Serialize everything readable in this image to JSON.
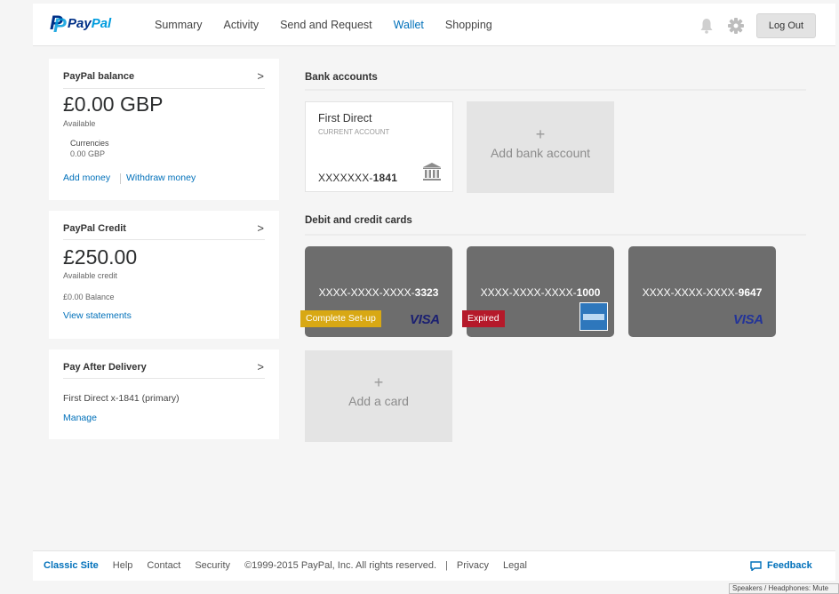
{
  "header": {
    "logo_pay": "Pay",
    "logo_pal": "Pal",
    "nav": [
      "Summary",
      "Activity",
      "Send and Request",
      "Wallet",
      "Shopping"
    ],
    "active_tab": "Wallet",
    "logout_label": "Log Out"
  },
  "balance": {
    "title": "PayPal balance",
    "chevron": ">",
    "amount": "£0.00 GBP",
    "amount_label": "Available",
    "currencies_label": "Currencies",
    "currencies_value": "0.00 GBP",
    "add_money": "Add money",
    "withdraw_money": "Withdraw money"
  },
  "credit": {
    "title": "PayPal Credit",
    "chevron": ">",
    "amount": "£250.00",
    "amount_label": "Available credit",
    "balance_line": "£0.00 Balance",
    "view_statements": "View statements"
  },
  "pay_after": {
    "title": "Pay After Delivery",
    "chevron": ">",
    "account": "First Direct x-1841 (primary)",
    "manage": "Manage"
  },
  "bank_section": {
    "title": "Bank accounts",
    "bank": {
      "name": "First Direct",
      "type": "CURRENT ACCOUNT",
      "number_prefix": "XXXXXXX-",
      "number_suffix": "1841"
    },
    "add_plus": "+",
    "add_label": "Add bank account"
  },
  "cards_section": {
    "title": "Debit and credit cards",
    "cards": [
      {
        "prefix": "XXXX-XXXX-XXXX-",
        "suffix": "3323",
        "badge": "Complete Set-up",
        "brand": "VISA"
      },
      {
        "prefix": "XXXX-XXXX-XXXX-",
        "suffix": "1000",
        "badge": "Expired",
        "brand": "amex-logo"
      },
      {
        "prefix": "XXXX-XXXX-XXXX-",
        "suffix": "9647",
        "badge": "",
        "brand": "VISA"
      }
    ],
    "add_plus": "+",
    "add_label": "Add a card"
  },
  "footer": {
    "classic_site": "Classic Site",
    "help": "Help",
    "contact": "Contact",
    "security": "Security",
    "copyright": "©1999-2015 PayPal, Inc. All rights reserved.",
    "pipe": "|",
    "privacy": "Privacy",
    "legal": "Legal",
    "feedback": "Feedback"
  },
  "status_tooltip": "Speakers / Headphones: Mute",
  "colors": {
    "brand_dark": "#003087",
    "brand_light": "#009cde",
    "link": "#0070ba",
    "card_gray": "#6d6d6d",
    "badge_setup": "#d8a814",
    "badge_expired": "#b5192a"
  }
}
